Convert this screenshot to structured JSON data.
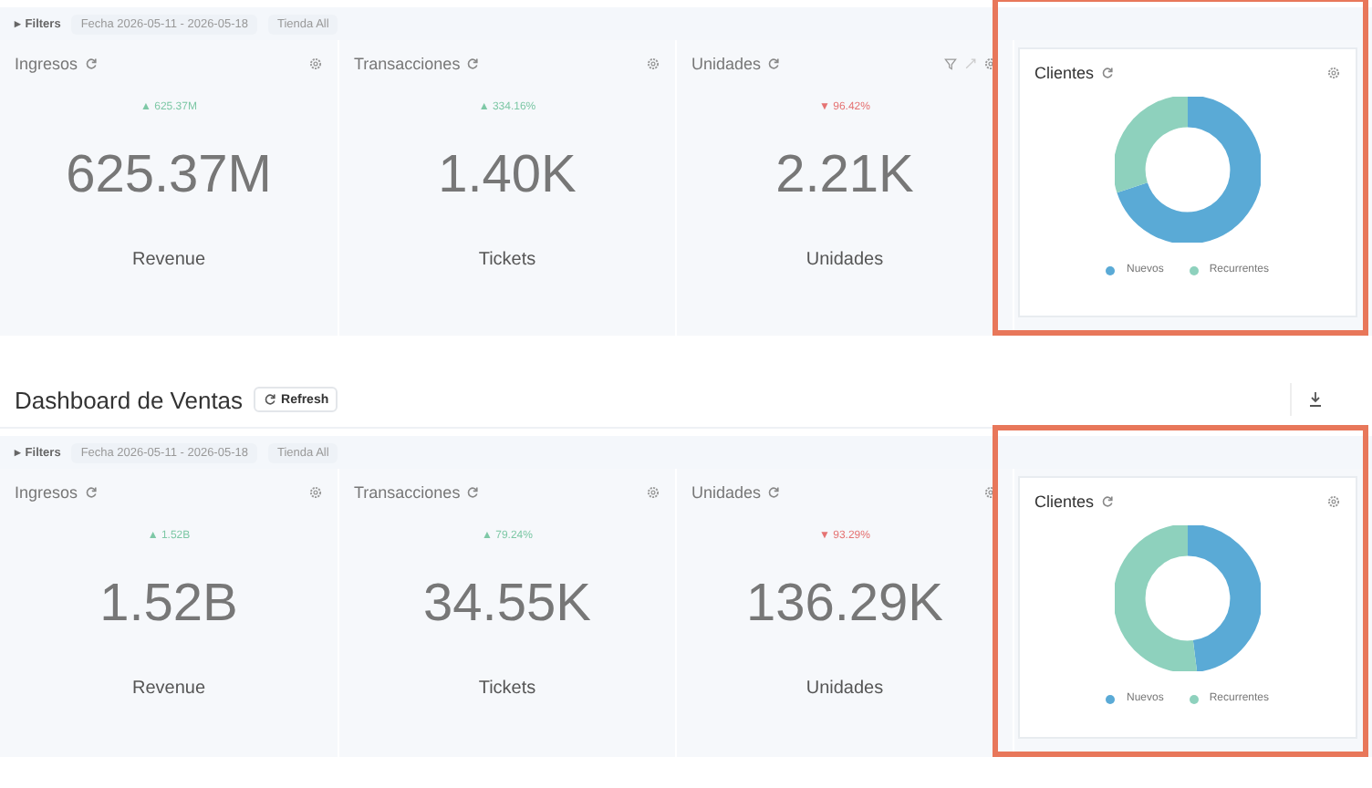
{
  "sections": [
    {
      "filters": {
        "label": "▸ Filters",
        "chips": [
          "Fecha 2026-05-11 - 2026-05-18",
          "Tienda All"
        ]
      },
      "metrics": [
        {
          "title": "Ingresos",
          "delta": "▲ 625.37M",
          "color": "#7ec8a6",
          "value": "625.37M",
          "label": "Revenue",
          "tools": false
        },
        {
          "title": "Transacciones",
          "delta": "▲ 334.16%",
          "color": "#7ec8a6",
          "value": "1.40K",
          "label": "Tickets",
          "tools": false
        },
        {
          "title": "Unidades",
          "delta": "▼ 96.42%",
          "color": "#e57373",
          "value": "2.21K",
          "label": "Unidades",
          "tools": true
        }
      ],
      "clientes": {
        "title": "Clientes",
        "highlighted": true,
        "legend": [
          {
            "name": "Nuevos",
            "color": "#5aaad6"
          },
          {
            "name": "Recurrentes",
            "color": "#8ed1bd"
          }
        ]
      }
    },
    {
      "title": "Dashboard de Ventas",
      "refresh": "Refresh",
      "filters": {
        "label": "▸ Filters",
        "chips": [
          "Fecha 2026-05-11 - 2026-05-18",
          "Tienda All"
        ]
      },
      "metrics": [
        {
          "title": "Ingresos",
          "delta": "▲ 1.52B",
          "color": "#7ec8a6",
          "value": "1.52B",
          "label": "Revenue",
          "tools": false
        },
        {
          "title": "Transacciones",
          "delta": "▲ 79.24%",
          "color": "#7ec8a6",
          "value": "34.55K",
          "label": "Tickets",
          "tools": false
        },
        {
          "title": "Unidades",
          "delta": "▼ 93.29%",
          "color": "#e57373",
          "value": "136.29K",
          "label": "Unidades",
          "tools": false
        }
      ],
      "clientes": {
        "title": "Clientes",
        "highlighted": true,
        "legend": [
          {
            "name": "Nuevos",
            "color": "#5aaad6"
          },
          {
            "name": "Recurrentes",
            "color": "#8ed1bd"
          }
        ]
      }
    }
  ]
}
